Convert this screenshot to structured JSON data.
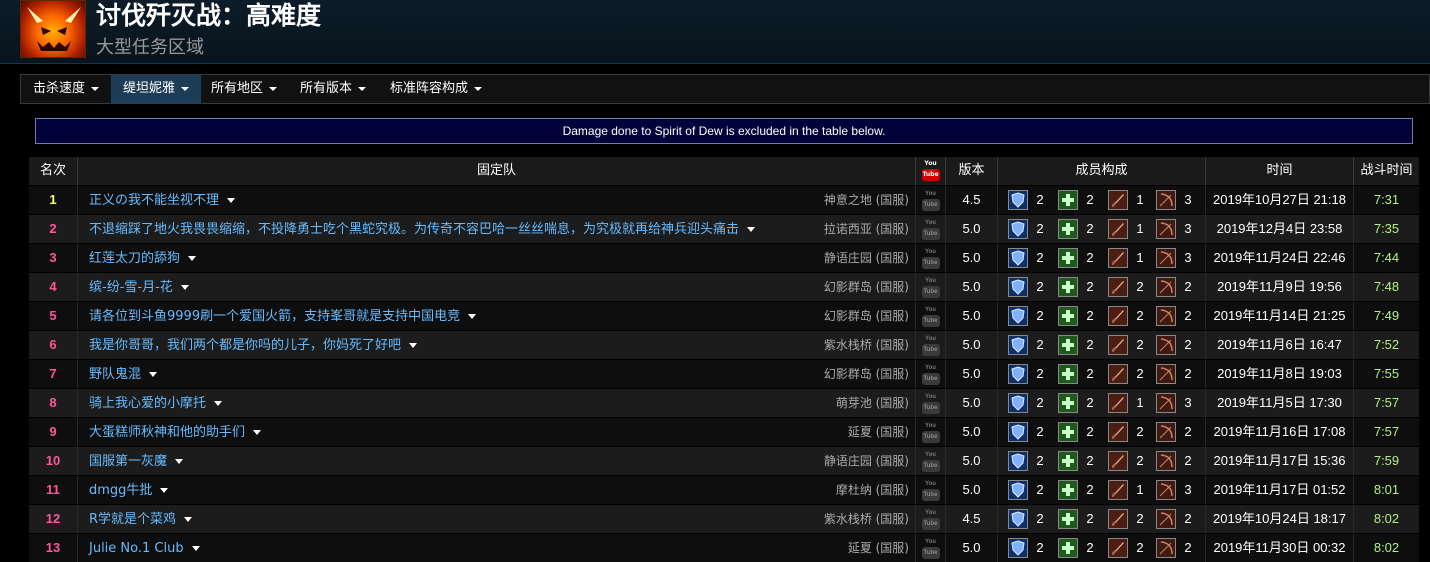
{
  "header": {
    "title": "讨伐歼灭战：高难度",
    "subtitle": "大型任务区域",
    "icon": "zone-emblem-icon"
  },
  "filters": [
    {
      "label": "击杀速度",
      "active": false
    },
    {
      "label": "缇坦妮雅",
      "active": true
    },
    {
      "label": "所有地区",
      "active": false
    },
    {
      "label": "所有版本",
      "active": false
    },
    {
      "label": "标准阵容构成",
      "active": false
    }
  ],
  "notice": "Damage done to Spirit of Dew is excluded in the table below.",
  "table": {
    "headers": {
      "rank": "名次",
      "team": "固定队",
      "video_icon": "youtube-icon",
      "version": "版本",
      "composition": "成员构成",
      "date": "时间",
      "duration": "战斗时间"
    },
    "role_icons": [
      "tank-shield-icon",
      "healer-cross-icon",
      "melee-sword-icon",
      "ranged-bow-icon"
    ],
    "rows": [
      {
        "rank": "1",
        "rank_color": "#ffff66",
        "team": "正义の我不能坐视不理",
        "server": "神意之地 (国服)",
        "version": "4.5",
        "comp": [
          "2",
          "2",
          "1",
          "3"
        ],
        "date": "2019年10月27日 21:18",
        "duration": "7:31"
      },
      {
        "rank": "2",
        "rank_color": "#ff5599",
        "team": "不退缩踩了地火我畏畏缩缩，不投降勇士吃个黑蛇究极。为传奇不容巴哈一丝丝喘息，为究极就再给神兵迎头痛击",
        "server": "拉诺西亚 (国服)",
        "version": "5.0",
        "comp": [
          "2",
          "2",
          "1",
          "3"
        ],
        "date": "2019年12月4日 23:58",
        "duration": "7:35"
      },
      {
        "rank": "3",
        "rank_color": "#ff5599",
        "team": "红莲太刀的舔狗",
        "server": "静语庄园 (国服)",
        "version": "5.0",
        "comp": [
          "2",
          "2",
          "1",
          "3"
        ],
        "date": "2019年11月24日 22:46",
        "duration": "7:44"
      },
      {
        "rank": "4",
        "rank_color": "#ff5599",
        "team": "缤-纷-雪-月-花",
        "server": "幻影群岛 (国服)",
        "version": "5.0",
        "comp": [
          "2",
          "2",
          "2",
          "2"
        ],
        "date": "2019年11月9日 19:56",
        "duration": "7:48"
      },
      {
        "rank": "5",
        "rank_color": "#ff5599",
        "team": "请各位到斗鱼9999刷一个爱国火箭，支持峯哥就是支持中国电竞",
        "server": "幻影群岛 (国服)",
        "version": "5.0",
        "comp": [
          "2",
          "2",
          "2",
          "2"
        ],
        "date": "2019年11月14日 21:25",
        "duration": "7:49"
      },
      {
        "rank": "6",
        "rank_color": "#ff5599",
        "team": "我是你哥哥，我们两个都是你吗的儿子，你妈死了好吧",
        "server": "紫水栈桥 (国服)",
        "version": "5.0",
        "comp": [
          "2",
          "2",
          "2",
          "2"
        ],
        "date": "2019年11月6日 16:47",
        "duration": "7:52"
      },
      {
        "rank": "7",
        "rank_color": "#ff5599",
        "team": "野队鬼混",
        "server": "幻影群岛 (国服)",
        "version": "5.0",
        "comp": [
          "2",
          "2",
          "2",
          "2"
        ],
        "date": "2019年11月8日 19:03",
        "duration": "7:55"
      },
      {
        "rank": "8",
        "rank_color": "#ff5599",
        "team": "骑上我心爱的小摩托",
        "server": "萌芽池 (国服)",
        "version": "5.0",
        "comp": [
          "2",
          "2",
          "1",
          "3"
        ],
        "date": "2019年11月5日 17:30",
        "duration": "7:57"
      },
      {
        "rank": "9",
        "rank_color": "#ff5599",
        "team": "大蛋糕师秋神和他的助手们",
        "server": "延夏 (国服)",
        "version": "5.0",
        "comp": [
          "2",
          "2",
          "2",
          "2"
        ],
        "date": "2019年11月16日 17:08",
        "duration": "7:57"
      },
      {
        "rank": "10",
        "rank_color": "#ff5599",
        "team": "国服第一灰魔",
        "server": "静语庄园 (国服)",
        "version": "5.0",
        "comp": [
          "2",
          "2",
          "2",
          "2"
        ],
        "date": "2019年11月17日 15:36",
        "duration": "7:59"
      },
      {
        "rank": "11",
        "rank_color": "#ff5599",
        "team": "dmgg牛批",
        "server": "摩杜纳 (国服)",
        "version": "5.0",
        "comp": [
          "2",
          "2",
          "1",
          "3"
        ],
        "date": "2019年11月17日 01:52",
        "duration": "8:01"
      },
      {
        "rank": "12",
        "rank_color": "#ff5599",
        "team": "R学就是个菜鸡",
        "server": "紫水栈桥 (国服)",
        "version": "4.5",
        "comp": [
          "2",
          "2",
          "2",
          "2"
        ],
        "date": "2019年10月24日 18:17",
        "duration": "8:02"
      },
      {
        "rank": "13",
        "rank_color": "#ff5599",
        "team": "Julie No.1 Club",
        "server": "延夏 (国服)",
        "version": "5.0",
        "comp": [
          "2",
          "2",
          "2",
          "2"
        ],
        "date": "2019年11月30日 00:32",
        "duration": "8:02"
      }
    ]
  }
}
